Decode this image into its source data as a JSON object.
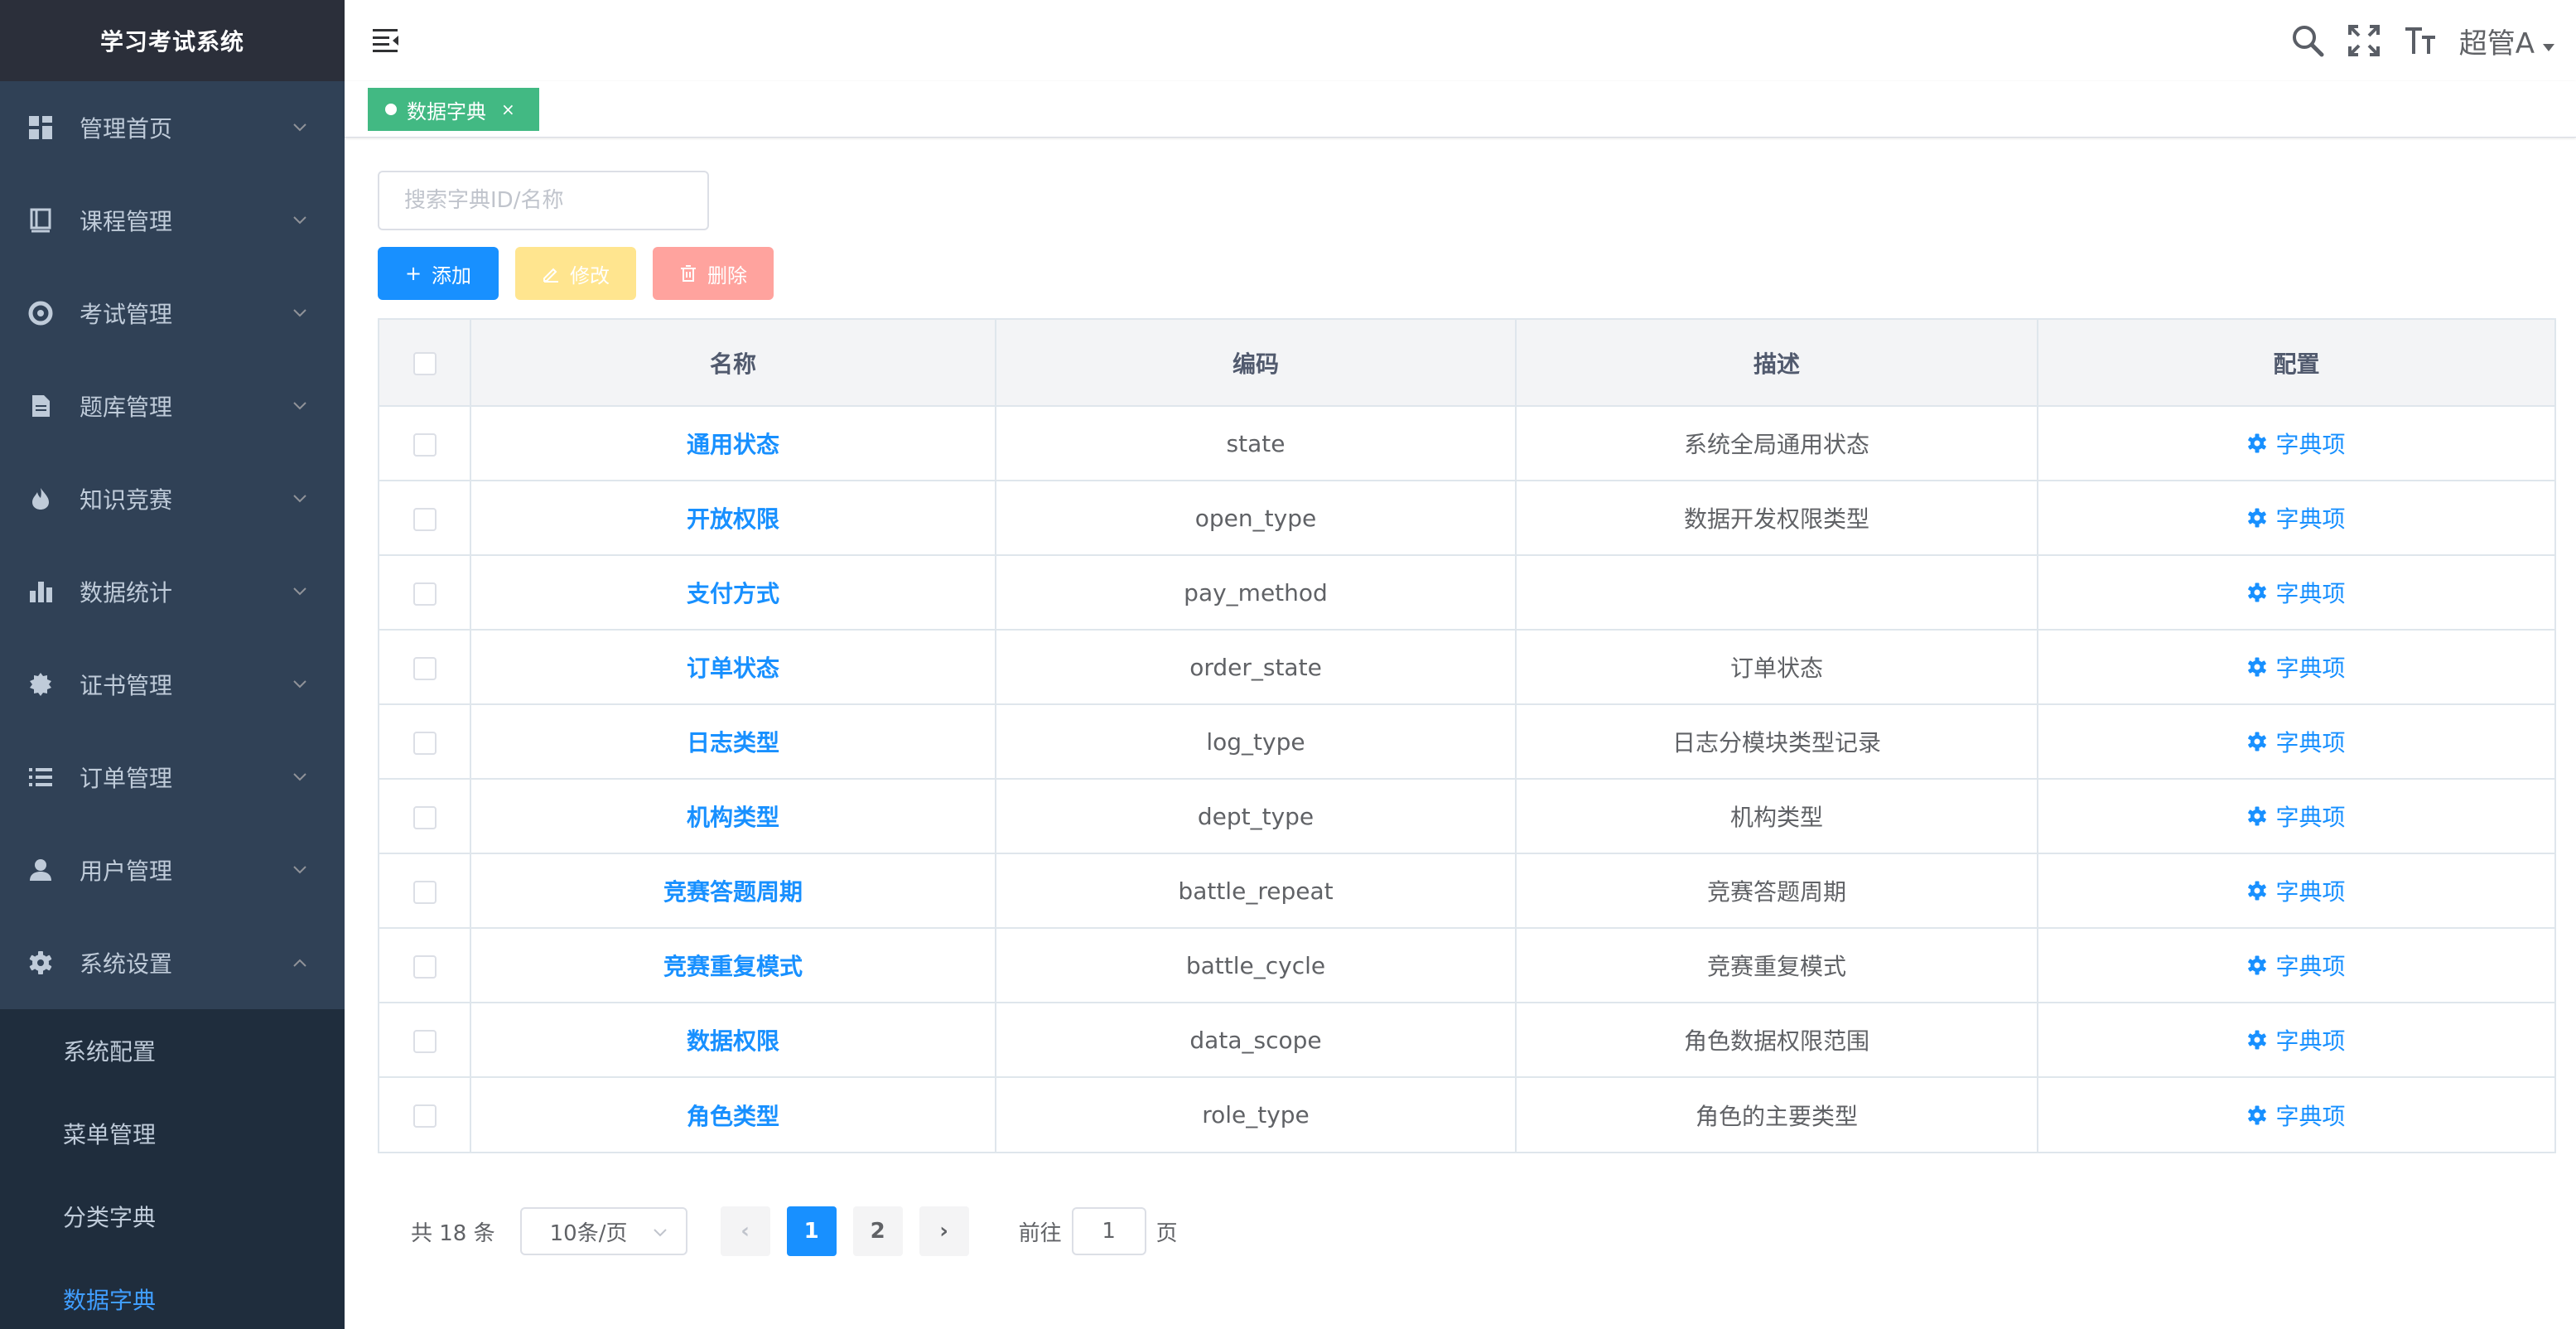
{
  "app": {
    "title": "学习考试系统"
  },
  "sidebar": {
    "items": [
      {
        "label": "管理首页",
        "icon": "dashboard-icon",
        "expanded": false
      },
      {
        "label": "课程管理",
        "icon": "course-icon",
        "expanded": false
      },
      {
        "label": "考试管理",
        "icon": "exam-icon",
        "expanded": false
      },
      {
        "label": "题库管理",
        "icon": "question-bank-icon",
        "expanded": false
      },
      {
        "label": "知识竞赛",
        "icon": "fire-icon",
        "expanded": false
      },
      {
        "label": "数据统计",
        "icon": "bar-chart-icon",
        "expanded": false
      },
      {
        "label": "证书管理",
        "icon": "certificate-icon",
        "expanded": false
      },
      {
        "label": "订单管理",
        "icon": "list-icon",
        "expanded": false
      },
      {
        "label": "用户管理",
        "icon": "user-icon",
        "expanded": false
      },
      {
        "label": "系统设置",
        "icon": "gear-icon",
        "expanded": true
      }
    ],
    "submenu": [
      {
        "label": "系统配置",
        "active": false
      },
      {
        "label": "菜单管理",
        "active": false
      },
      {
        "label": "分类字典",
        "active": false
      },
      {
        "label": "数据字典",
        "active": true
      }
    ]
  },
  "header": {
    "user_name": "超管A",
    "icons": [
      "hamburger-icon",
      "search-icon",
      "fullscreen-icon",
      "font-size-icon"
    ]
  },
  "tags": [
    {
      "label": "数据字典",
      "close": "×",
      "active": true
    }
  ],
  "search": {
    "placeholder": "搜索字典ID/名称",
    "value": ""
  },
  "toolbar": {
    "add": {
      "icon": "+",
      "label": "添加"
    },
    "edit": {
      "label": "修改"
    },
    "delete": {
      "label": "删除"
    }
  },
  "table": {
    "columns": [
      "名称",
      "编码",
      "描述",
      "配置"
    ],
    "rows": [
      {
        "name": "通用状态",
        "code": "state",
        "desc": "系统全局通用状态",
        "config": "字典项"
      },
      {
        "name": "开放权限",
        "code": "open_type",
        "desc": "数据开发权限类型",
        "config": "字典项"
      },
      {
        "name": "支付方式",
        "code": "pay_method",
        "desc": "",
        "config": "字典项"
      },
      {
        "name": "订单状态",
        "code": "order_state",
        "desc": "订单状态",
        "config": "字典项"
      },
      {
        "name": "日志类型",
        "code": "log_type",
        "desc": "日志分模块类型记录",
        "config": "字典项"
      },
      {
        "name": "机构类型",
        "code": "dept_type",
        "desc": "机构类型",
        "config": "字典项"
      },
      {
        "name": "竞赛答题周期",
        "code": "battle_repeat",
        "desc": "竞赛答题周期",
        "config": "字典项"
      },
      {
        "name": "竞赛重复模式",
        "code": "battle_cycle",
        "desc": "竞赛重复模式",
        "config": "字典项"
      },
      {
        "name": "数据权限",
        "code": "data_scope",
        "desc": "角色数据权限范围",
        "config": "字典项"
      },
      {
        "name": "角色类型",
        "code": "role_type",
        "desc": "角色的主要类型",
        "config": "字典项"
      }
    ]
  },
  "pagination": {
    "total_text": "共 18 条",
    "page_size": "10条/页",
    "pages": [
      "1",
      "2"
    ],
    "current": "1",
    "prev": "‹",
    "next": "›",
    "goto_label": "前往",
    "goto_value": "1",
    "page_suffix": "页"
  },
  "colors": {
    "sidebar_bg": "#304156",
    "logo_bg": "#2b2f3a",
    "submenu_bg": "#1f2d3d",
    "primary": "#1890ff",
    "tag_active": "#42b983",
    "warning_light": "#ffe58f",
    "danger_light": "#ffa39e"
  }
}
